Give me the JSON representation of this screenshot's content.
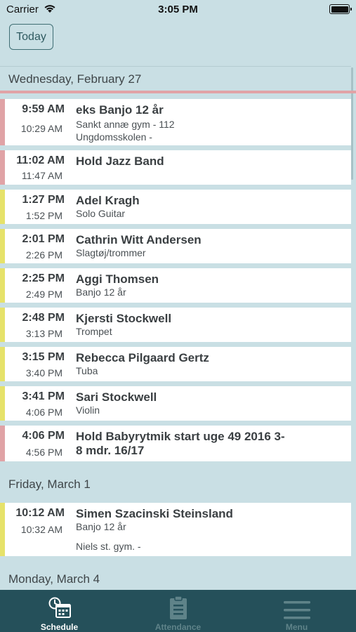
{
  "status_bar": {
    "carrier": "Carrier",
    "time": "3:05 PM"
  },
  "toolbar": {
    "today_label": "Today"
  },
  "days": [
    {
      "header": "Wednesday, February 27",
      "events": [
        {
          "start": "9:59 AM",
          "end": "10:29 AM",
          "title": "eks Banjo 12 år",
          "lines": [
            "Sankt annæ gym  -  112",
            "Ungdomsskolen  -"
          ],
          "color": "red"
        },
        {
          "start": "11:02 AM",
          "end": "11:47 AM",
          "title": "Hold Jazz Band",
          "lines": [],
          "color": "red"
        },
        {
          "start": "1:27 PM",
          "end": "1:52 PM",
          "title": "Adel Kragh",
          "lines": [
            "Solo Guitar"
          ],
          "color": "yellow"
        },
        {
          "start": "2:01 PM",
          "end": "2:26 PM",
          "title": "Cathrin Witt Andersen",
          "lines": [
            "Slagtøj/trommer"
          ],
          "color": "yellow"
        },
        {
          "start": "2:25 PM",
          "end": "2:49 PM",
          "title": "Aggi Thomsen",
          "lines": [
            "Banjo 12 år"
          ],
          "color": "yellow"
        },
        {
          "start": "2:48 PM",
          "end": "3:13 PM",
          "title": "Kjersti Stockwell",
          "lines": [
            "Trompet"
          ],
          "color": "yellow"
        },
        {
          "start": "3:15 PM",
          "end": "3:40 PM",
          "title": "Rebecca Pilgaard Gertz",
          "lines": [
            "Tuba"
          ],
          "color": "yellow"
        },
        {
          "start": "3:41 PM",
          "end": "4:06 PM",
          "title": "Sari Stockwell",
          "lines": [
            "Violin"
          ],
          "color": "yellow"
        },
        {
          "start": "4:06 PM",
          "end": "4:56 PM",
          "title": "Hold Babyrytmik start uge 49 2016 3-8 mdr. 16/17",
          "lines": [],
          "color": "red"
        }
      ]
    },
    {
      "header": "Friday, March 1",
      "events": [
        {
          "start": "10:12 AM",
          "end": "10:32 AM",
          "title": "Simen Szacinski Steinsland",
          "lines": [
            "Banjo 12 år",
            "Niels st. gym.  -"
          ],
          "color": "yellow"
        }
      ]
    },
    {
      "header": "Monday, March 4",
      "events": []
    }
  ],
  "tabs": [
    {
      "label": "Schedule",
      "icon": "schedule-icon",
      "active": true
    },
    {
      "label": "Attendance",
      "icon": "clipboard-icon",
      "active": false
    },
    {
      "label": "Menu",
      "icon": "hamburger-icon",
      "active": false
    }
  ],
  "colors": {
    "red": "#e0a3a6",
    "yellow": "#e6e26a",
    "tab_bar": "#25505a",
    "background": "#c9dfe4"
  }
}
